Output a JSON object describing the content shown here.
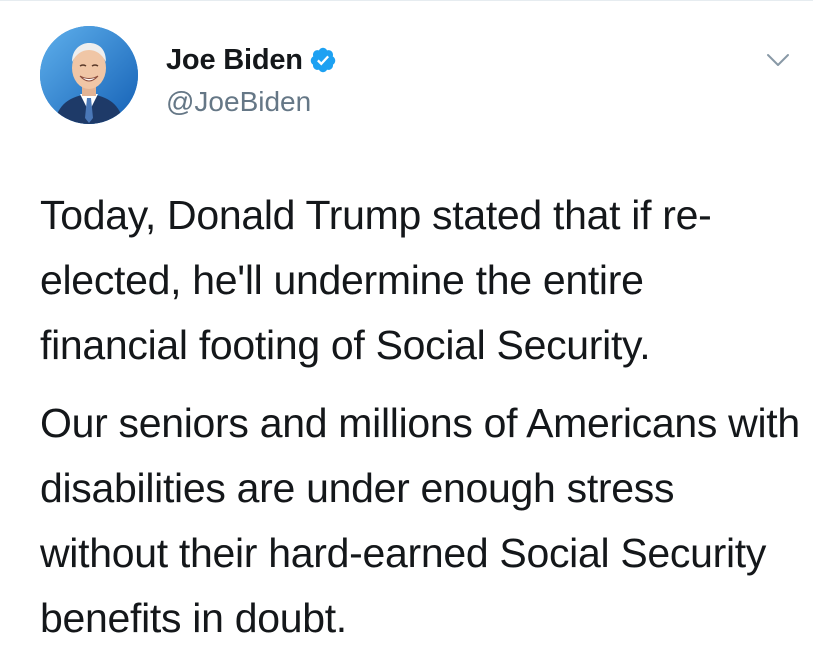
{
  "tweet": {
    "author": {
      "display_name": "Joe Biden",
      "handle": "@JoeBiden",
      "verified": true,
      "avatar_icon": "avatar-photo"
    },
    "menu_icon": "chevron-down-icon",
    "paragraphs": [
      "Today, Donald Trump stated that if re-elected, he'll undermine the entire financial footing of Social Security.",
      "Our seniors and millions of Americans with disabilities are under enough stress without their hard-earned Social Security benefits in doubt."
    ]
  },
  "colors": {
    "text": "#14171a",
    "secondary_text": "#657786",
    "verified_blue": "#1da1f2",
    "divider": "#e6ecf0"
  }
}
